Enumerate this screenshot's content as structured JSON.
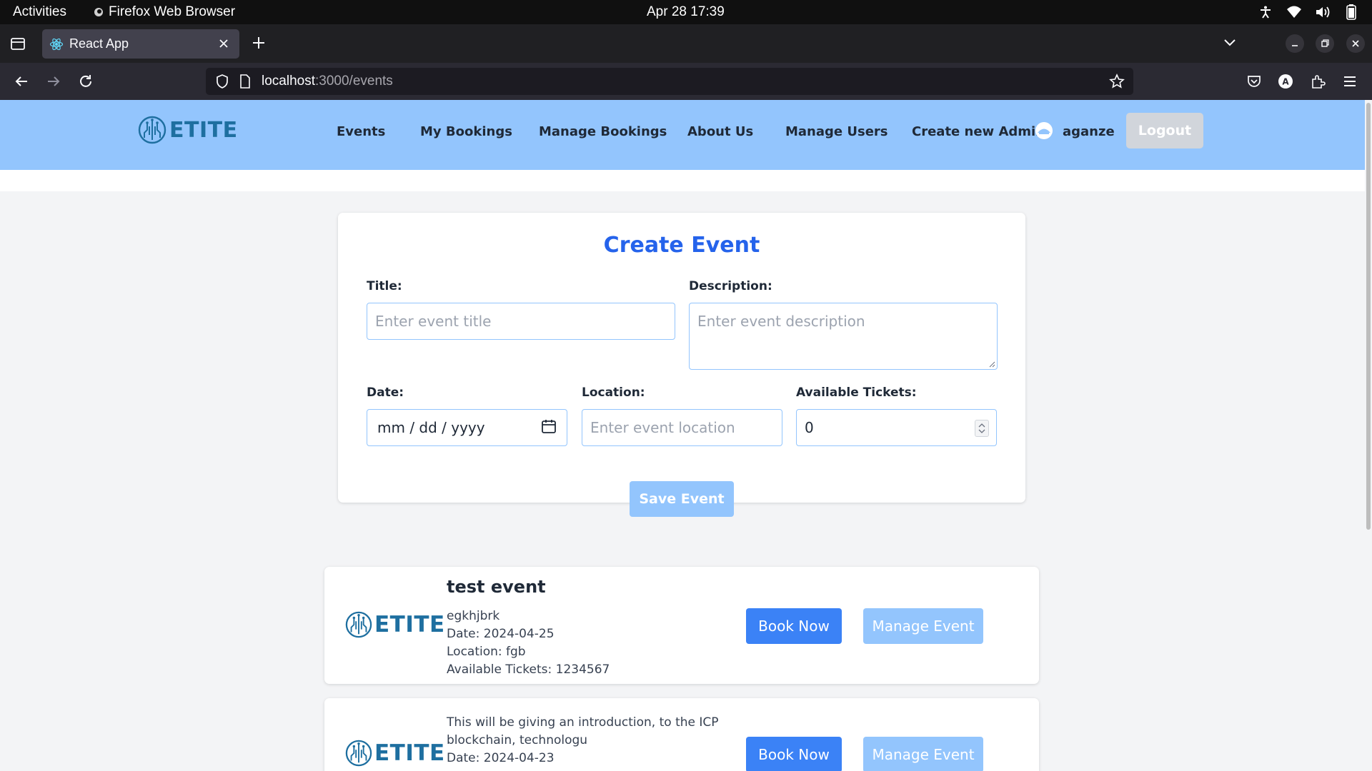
{
  "os": {
    "activities": "Activities",
    "app_name": "Firefox Web Browser",
    "clock": "Apr 28  17:39"
  },
  "browser": {
    "tab_title": "React App",
    "url_host": "localhost",
    "url_rest": ":3000/events"
  },
  "site": {
    "logo_text": "ETITE",
    "nav": {
      "events": "Events",
      "my_bookings": "My Bookings",
      "manage_bookings": "Manage Bookings",
      "about_us": "About Us",
      "manage_users": "Manage Users",
      "create_admins": "Create new Admins"
    },
    "username": "aganze",
    "logout": "Logout"
  },
  "create_form": {
    "heading": "Create Event",
    "title_label": "Title:",
    "title_placeholder": "Enter event title",
    "description_label": "Description:",
    "description_placeholder": "Enter event description",
    "date_label": "Date:",
    "date_placeholder": "mm / dd / yyyy",
    "location_label": "Location:",
    "location_placeholder": "Enter event location",
    "tickets_label": "Available Tickets:",
    "tickets_value": "0",
    "save_button": "Save Event"
  },
  "events": [
    {
      "title": "test event",
      "description": "egkhjbrk",
      "date": "Date: 2024-04-25",
      "location": "Location: fgb",
      "tickets": "Available Tickets: 1234567",
      "book_label": "Book Now",
      "manage_label": "Manage Event"
    },
    {
      "description_line1": "This will be giving an introduction, to the ICP",
      "description_line2": "blockchain, technologu",
      "date": "Date: 2024-04-23",
      "book_label": "Book Now",
      "manage_label": "Manage Event"
    }
  ],
  "colors": {
    "header_bg": "#93c5fd",
    "accent": "#2563eb",
    "primary_button": "#3b82f6",
    "disabled_button": "#93c5fd",
    "logo": "#1e6fa0"
  }
}
